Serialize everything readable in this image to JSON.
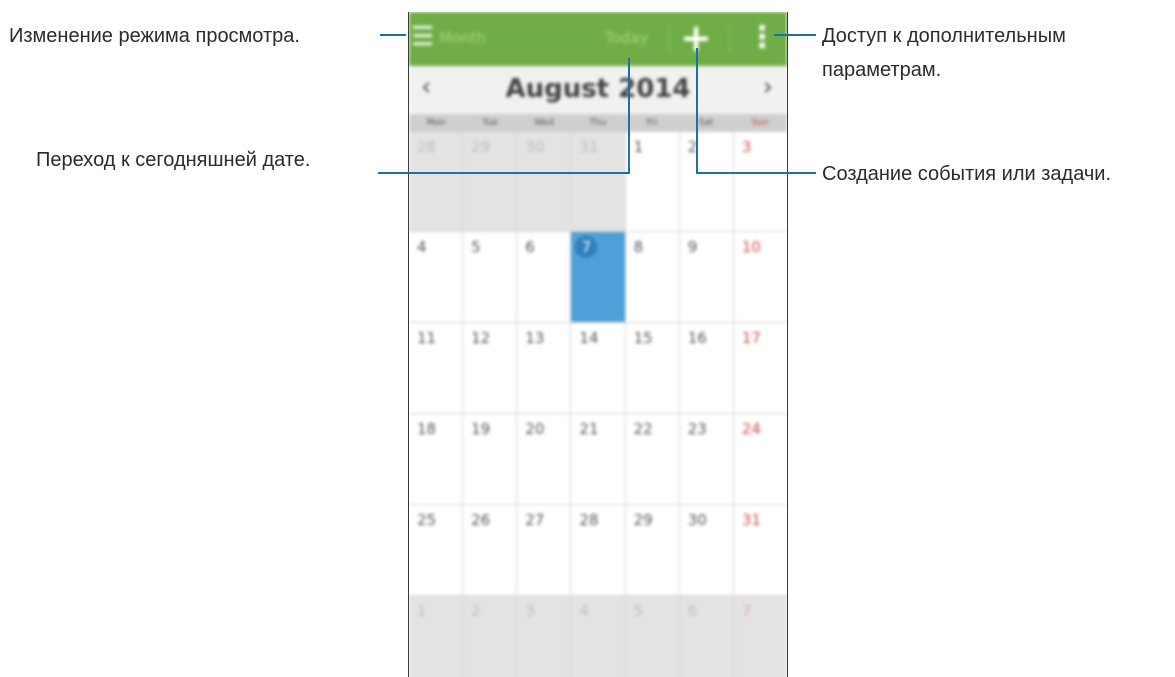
{
  "callouts": {
    "view_mode": "Изменение режима просмотра.",
    "go_today": "Переход к сегодняшней дате.",
    "more_options_line1": "Доступ к дополнительным",
    "more_options_line2": "параметрам.",
    "create_event": "Создание события или задачи."
  },
  "calendar": {
    "action_bar": {
      "view_label": "Month",
      "today_label": "Today",
      "add_symbol": "+",
      "more_symbol": "⋮",
      "menu_symbol": "☰"
    },
    "month_title": "August 2014",
    "prev_symbol": "‹",
    "next_symbol": "›",
    "weekdays": [
      "Mon",
      "Tue",
      "Wed",
      "Thu",
      "Fri",
      "Sat",
      "Sun"
    ],
    "weeks": [
      [
        "28",
        "29",
        "30",
        "31",
        "1",
        "2",
        "3"
      ],
      [
        "4",
        "5",
        "6",
        "7",
        "8",
        "9",
        "10"
      ],
      [
        "11",
        "12",
        "13",
        "14",
        "15",
        "16",
        "17"
      ],
      [
        "18",
        "19",
        "20",
        "21",
        "22",
        "23",
        "24"
      ],
      [
        "25",
        "26",
        "27",
        "28",
        "29",
        "30",
        "31"
      ],
      [
        "1",
        "2",
        "3",
        "4",
        "5",
        "6",
        "7"
      ]
    ],
    "today": "7",
    "colors": {
      "action_bar": "#6fae46",
      "today_highlight": "#4f9fd8",
      "sunday": "#d04a45",
      "callout_line": "#1f6fa8"
    }
  }
}
